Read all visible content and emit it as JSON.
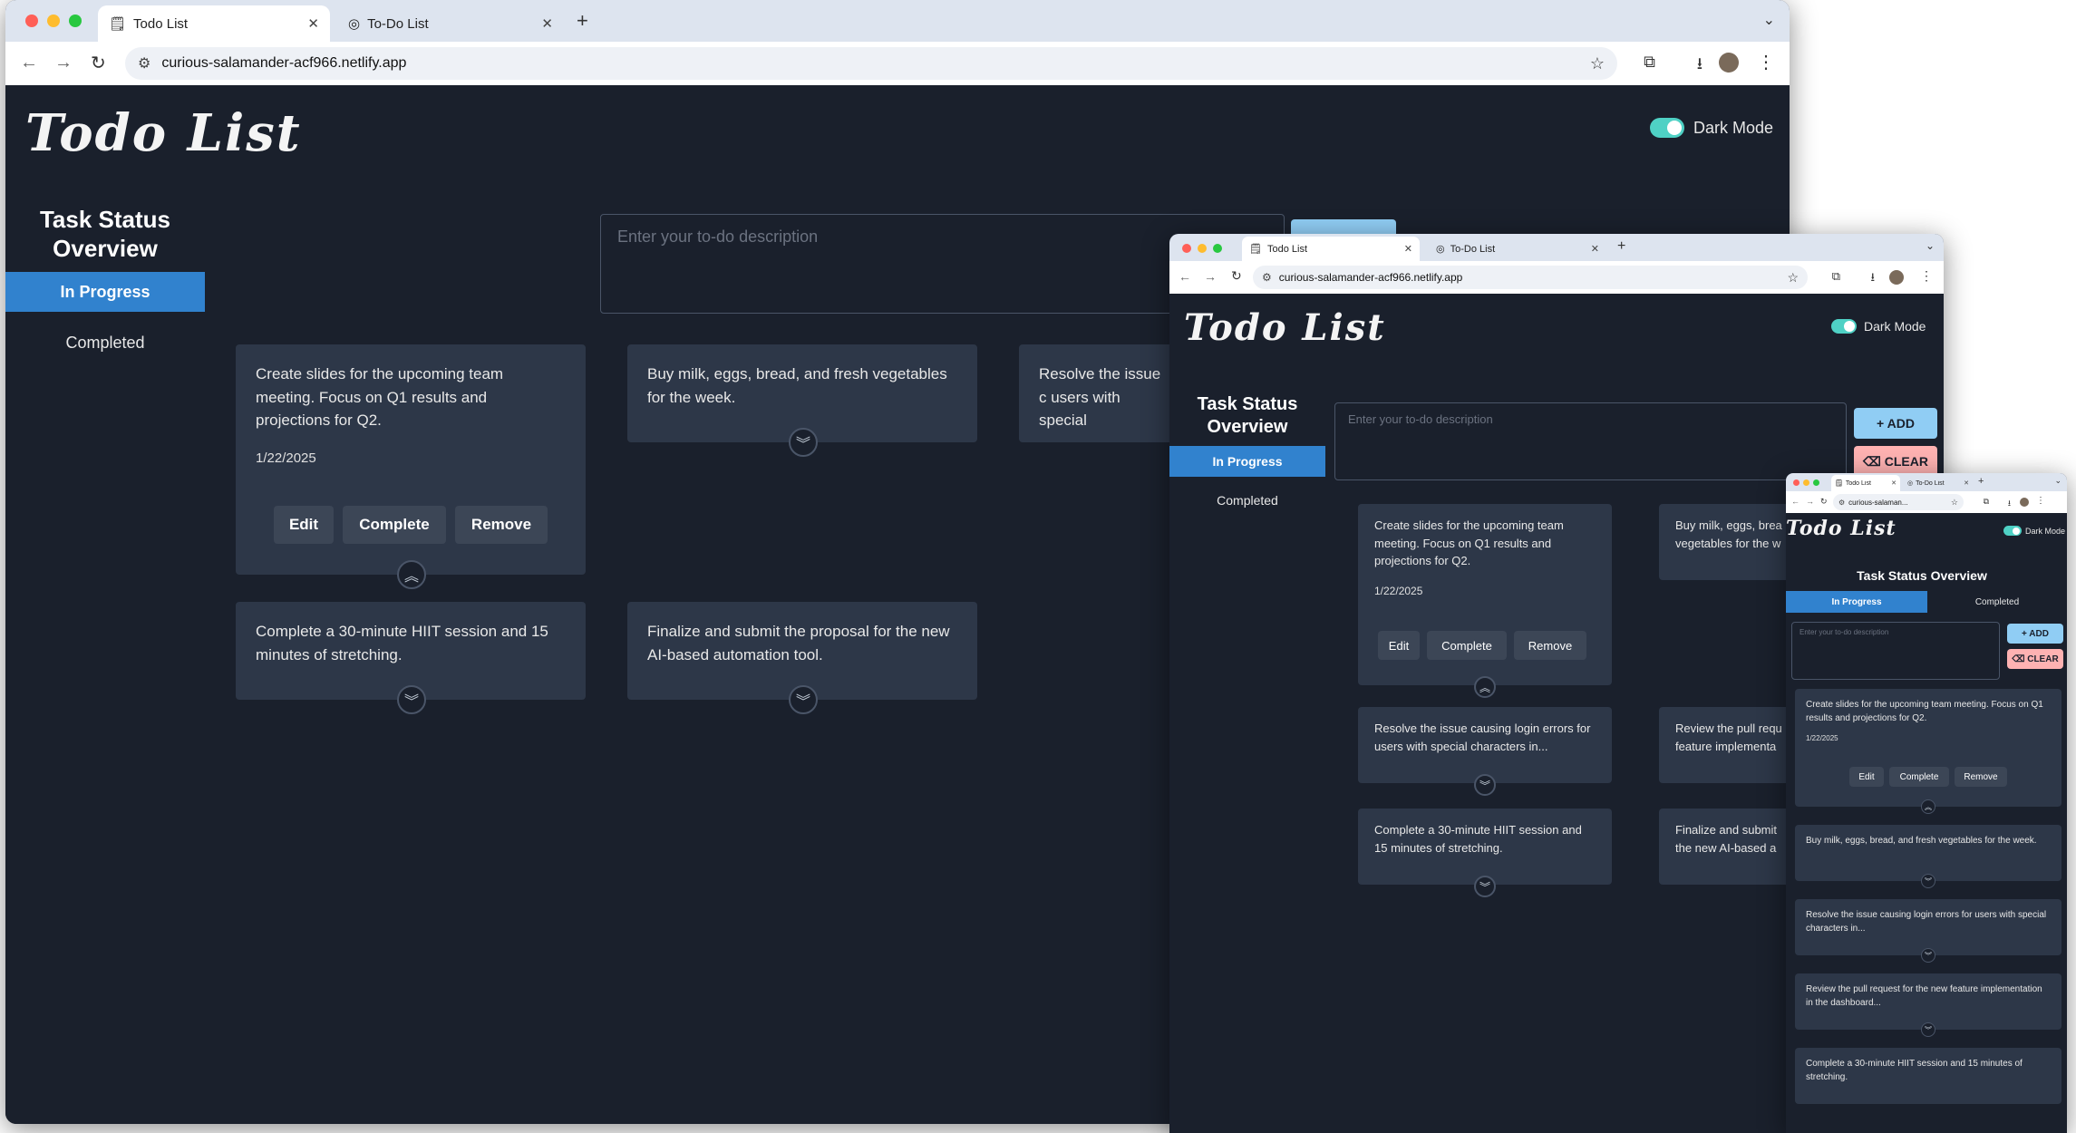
{
  "browser": {
    "tabs": [
      {
        "title": "Todo List",
        "favicon": "notepad-icon",
        "active": true
      },
      {
        "title": "To-Do List",
        "favicon": "globe-icon",
        "active": false
      }
    ],
    "url": "curious-salamander-acf966.netlify.app"
  },
  "app": {
    "title": "Todo List",
    "dark_mode_label": "Dark Mode",
    "dark_mode_on": true,
    "sidebar_title": "Task Status Overview",
    "sidebar_items": [
      "In Progress",
      "Completed"
    ],
    "input_placeholder": "Enter your to-do description",
    "add_label": "+ ADD",
    "clear_label": "⌫ CLEAR",
    "actions": [
      "Edit",
      "Complete",
      "Remove"
    ]
  },
  "main_window": {
    "cards": [
      {
        "text": "Create slides for the upcoming team meeting. Focus on Q1 results and projections for Q2.",
        "date": "1/22/2025",
        "expanded": true
      },
      {
        "text": "Buy milk, eggs, bread, and fresh vegetables for the week.",
        "expanded": false
      },
      {
        "text": "Resolve the issue c users with special",
        "expanded": false
      },
      {
        "text": "Complete a 30-minute HIIT session and 15 minutes of stretching.",
        "expanded": false
      },
      {
        "text": "Finalize and submit the proposal for the new AI-based automation tool.",
        "expanded": false
      }
    ]
  },
  "mid_window": {
    "cards": [
      {
        "text": "Create slides for the upcoming team meeting. Focus on Q1 results and projections for Q2.",
        "date": "1/22/2025",
        "expanded": true
      },
      {
        "text": "Buy milk, eggs, brea vegetables for the w",
        "expanded": false
      },
      {
        "text": "Resolve the issue causing login errors for users with special characters in...",
        "expanded": false
      },
      {
        "text": "Review the pull requ feature implementa",
        "expanded": false
      },
      {
        "text": "Complete a 30-minute HIIT session and 15 minutes of stretching.",
        "expanded": false
      },
      {
        "text": "Finalize and submit the new AI-based a",
        "expanded": false
      }
    ]
  },
  "small_window": {
    "url": "curious-salaman...",
    "cards": [
      {
        "text": "Create slides for the upcoming team meeting. Focus on Q1 results and projections for Q2.",
        "date": "1/22/2025",
        "expanded": true
      },
      {
        "text": "Buy milk, eggs, bread, and fresh vegetables for the week.",
        "expanded": false
      },
      {
        "text": "Resolve the issue causing login errors for users with special characters in...",
        "expanded": false
      },
      {
        "text": "Review the pull request for the new feature implementation in the dashboard...",
        "expanded": false
      },
      {
        "text": "Complete a 30-minute HIIT session and 15 minutes of stretching.",
        "expanded": false
      }
    ]
  },
  "colors": {
    "page_bg": "#1a202c",
    "card_bg": "#2d3748",
    "sidebar_active": "#3182ce",
    "toggle": "#4fd1c5",
    "add_button": "#90cdf4",
    "clear_button": "#feb2b2"
  }
}
